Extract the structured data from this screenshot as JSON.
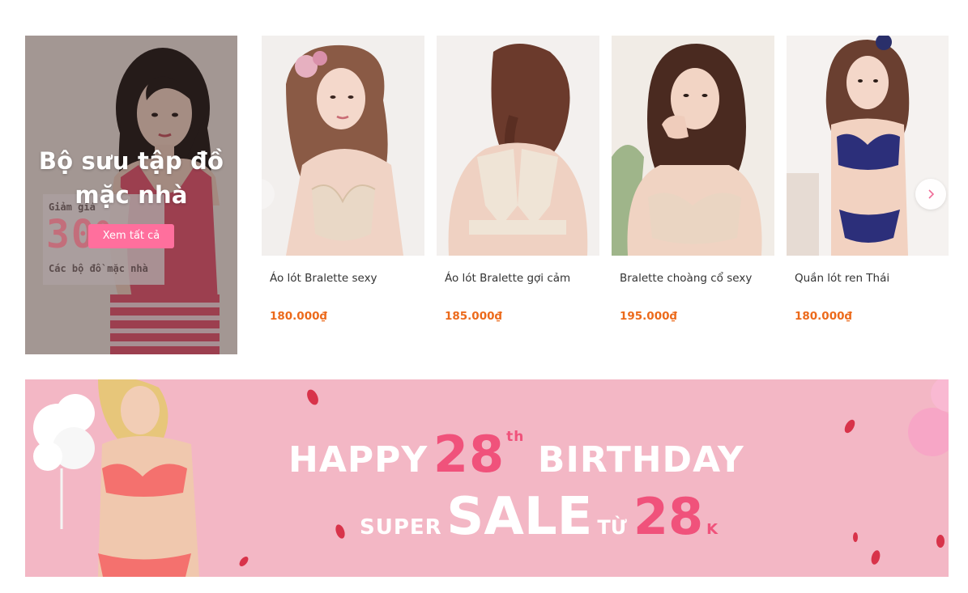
{
  "collection": {
    "title": "Bộ sưu tập đồ mặc nhà",
    "button_label": "Xem tất cả",
    "promo_line1": "Giảm giá",
    "promo_percent": "30%",
    "promo_line2": "Các bộ đồ mặc nhà"
  },
  "carousel": {
    "products": [
      {
        "name": "Áo lót Bralette sexy",
        "price": "180.000₫",
        "icon": "product-photo-lace-bralette"
      },
      {
        "name": "Áo lót Bralette gợi cảm",
        "price": "185.000₫",
        "icon": "product-photo-lace-back-bralette"
      },
      {
        "name": "Bralette choàng cổ sexy",
        "price": "195.000₫",
        "icon": "product-photo-halter-bralette"
      },
      {
        "name": "Quần lót ren Thái",
        "price": "180.000₫",
        "icon": "product-photo-navy-lace-set"
      }
    ],
    "prev_icon": "chevron-left-icon",
    "next_icon": "chevron-right-icon"
  },
  "sale_banner": {
    "happy": "HAPPY",
    "number": "28",
    "ordinal": "th",
    "birthday": "BIRTHDAY",
    "super": "SUPER",
    "sale": "SALE",
    "from": "TỪ",
    "amount": "28",
    "unit": "K"
  },
  "colors": {
    "accent_pink": "#ff6f9d",
    "price_orange": "#ec6a1b",
    "banner_pink": "#f3b7c5",
    "banner_number": "#f0527b"
  }
}
